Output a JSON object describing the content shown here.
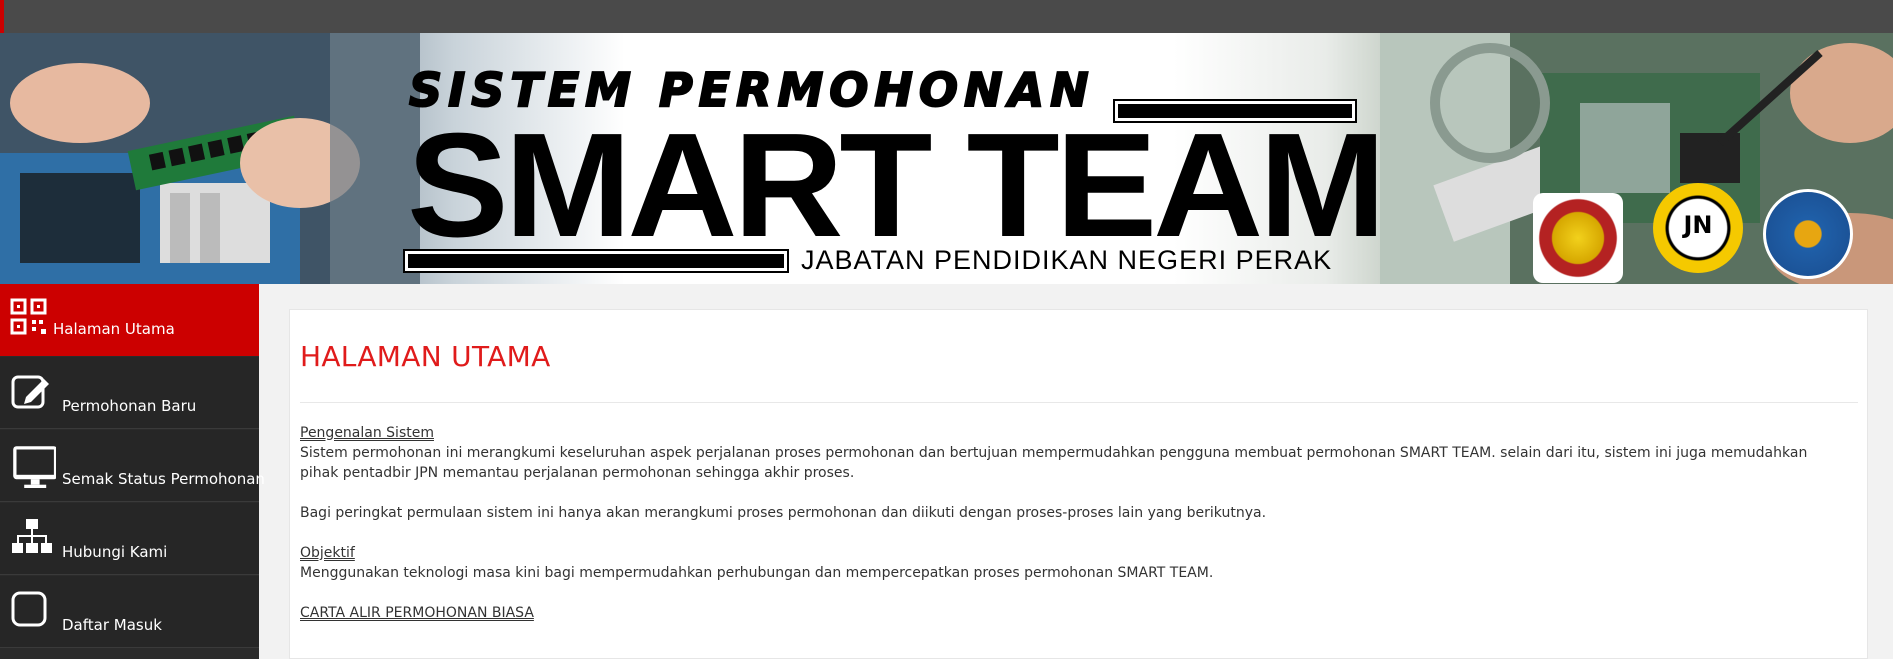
{
  "banner": {
    "title_small": "SISTEM PERMOHONAN",
    "title_big": "SMART TEAM",
    "subtitle": "JABATAN PENDIDIKAN NEGERI PERAK",
    "logo_2_text": "JN"
  },
  "sidebar": {
    "items": [
      {
        "label": "Halaman Utama",
        "icon": "qr-grid-icon",
        "active": true
      },
      {
        "label": "Permohonan Baru",
        "icon": "edit-icon",
        "active": false
      },
      {
        "label": "Semak Status Permohonan",
        "icon": "monitor-icon",
        "active": false
      },
      {
        "label": "Hubungi Kami",
        "icon": "sitemap-icon",
        "active": false
      },
      {
        "label": "Daftar Masuk",
        "icon": "login-icon",
        "active": false
      }
    ]
  },
  "main": {
    "title": "HALAMAN UTAMA",
    "intro_heading": "Pengenalan Sistem",
    "intro_text": "Sistem permohonan ini merangkumi keseluruhan aspek perjalanan proses permohonan dan bertujuan mempermudahkan pengguna membuat permohonan SMART TEAM. selain dari itu, sistem ini juga memudahkan pihak pentadbir JPN memantau perjalanan permohonan sehingga akhir proses.",
    "phase_text": "Bagi peringkat permulaan sistem ini hanya akan merangkumi proses permohonan dan diikuti dengan proses-proses lain yang berikutnya.",
    "objective_heading": "Objektif",
    "objective_text": "Menggunakan teknologi masa kini bagi mempermudahkan perhubungan dan mempercepatkan proses permohonan SMART TEAM.",
    "flow_link": "CARTA ALIR PERMOHONAN BIASA"
  },
  "colors": {
    "accent_red": "#cc0000",
    "title_red": "#e01b1b",
    "sidebar_bg": "#262626",
    "topbar_bg": "#4a4a4a"
  }
}
